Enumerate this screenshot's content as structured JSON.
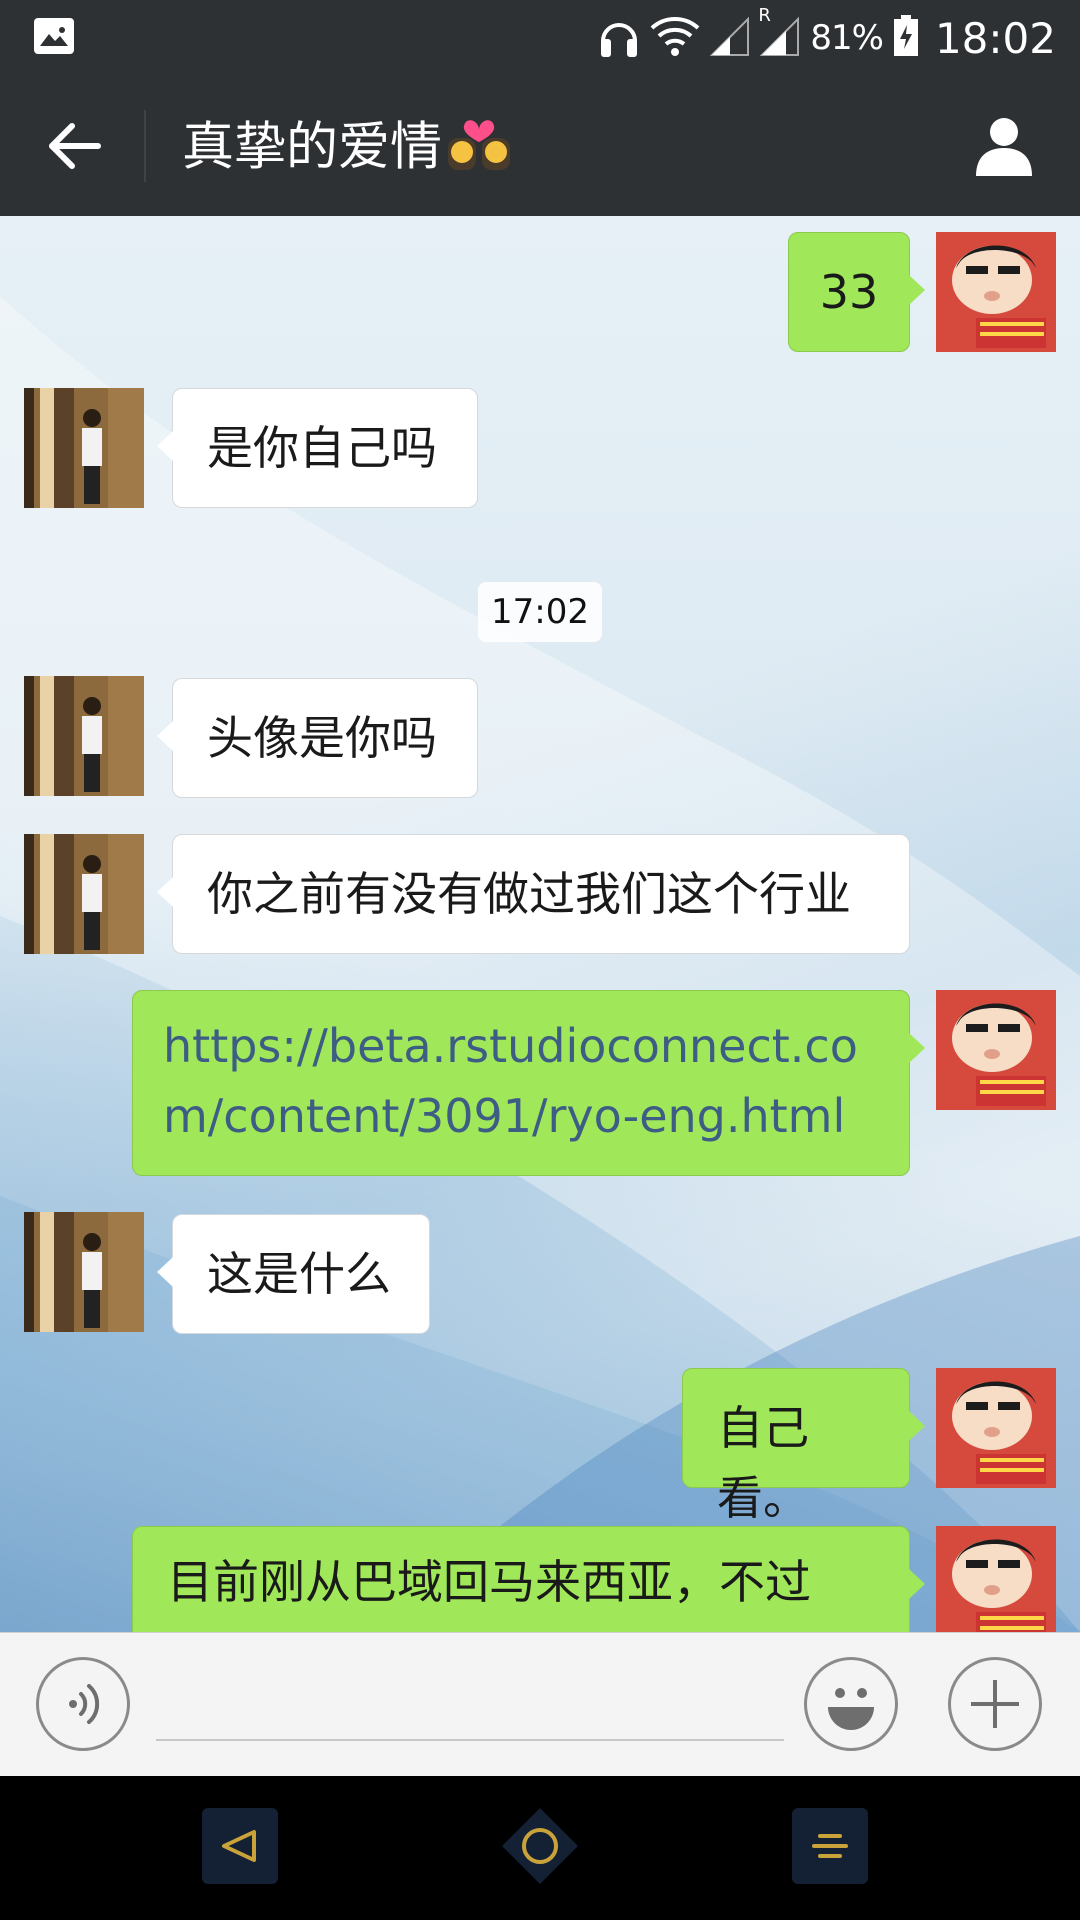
{
  "status_bar": {
    "battery_percent": "81%",
    "time": "18:02",
    "icons": [
      "gallery-icon",
      "headphones-icon",
      "wifi-icon",
      "signal-icon",
      "signal-roaming-icon",
      "battery-charging-icon"
    ],
    "roaming_label": "R"
  },
  "header": {
    "title": "真挚的爱情",
    "title_emoji": "couple-kiss-emoji",
    "back_icon": "arrow-left-icon",
    "profile_icon": "person-icon"
  },
  "chat": {
    "messages": [
      {
        "side": "out",
        "text": "33"
      },
      {
        "side": "in",
        "text": "是你自己吗"
      },
      {
        "side": "timestamp",
        "text": "17:02"
      },
      {
        "side": "in",
        "text": "头像是你吗"
      },
      {
        "side": "in",
        "text": "你之前有没有做过我们这个行业"
      },
      {
        "side": "out",
        "text": "https://beta.rstudioconnect.com/content/3091/ryo-eng.html",
        "is_link": true
      },
      {
        "side": "in",
        "text": "这是什么"
      },
      {
        "side": "out",
        "text": "自己看。"
      },
      {
        "side": "out",
        "text": "目前刚从巴域回马来西亚，不过"
      }
    ]
  },
  "input_bar": {
    "voice_icon": "voice-icon",
    "emoji_icon": "smiley-icon",
    "more_icon": "plus-icon",
    "placeholder": ""
  },
  "nav_bar": {
    "icons": [
      "nav-back-icon",
      "nav-home-icon",
      "nav-recents-icon"
    ]
  },
  "colors": {
    "header_bg": "#2e3134",
    "bubble_out": "#a0e75a",
    "bubble_in": "#ffffff",
    "link": "#3d5d84"
  }
}
